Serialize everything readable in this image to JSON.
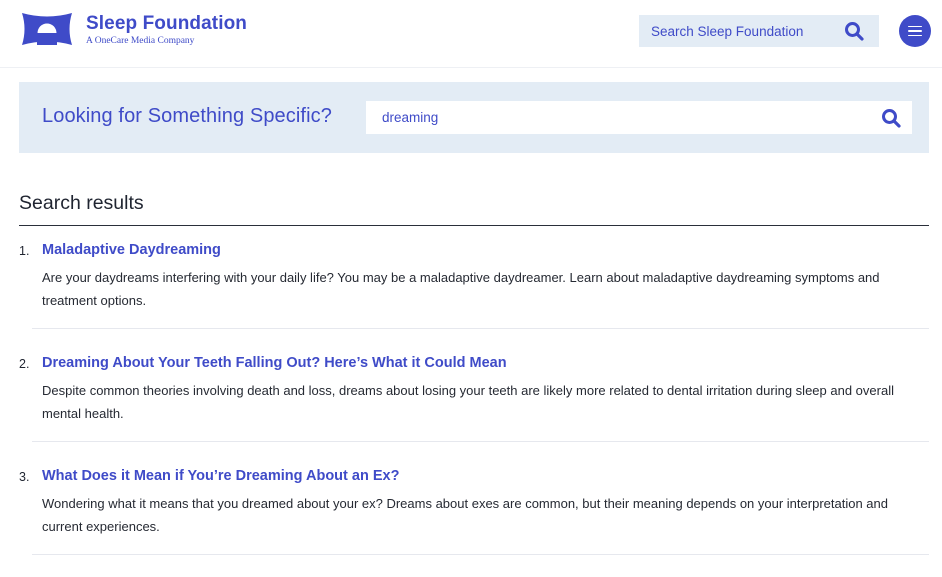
{
  "header": {
    "logo_title": "Sleep Foundation",
    "logo_subtitle": "A OneCare Media Company",
    "search_placeholder": "Search Sleep Foundation",
    "search_icon": "search-icon",
    "menu_icon": "menu-icon"
  },
  "search_panel": {
    "title": "Looking for Something Specific?",
    "query": "dreaming",
    "search_icon": "search-icon"
  },
  "results": {
    "heading": "Search results",
    "items": [
      {
        "number": "1.",
        "title": "Maladaptive Daydreaming",
        "description": "Are your daydreams interfering with your daily life? You may be a maladaptive daydreamer. Learn about maladaptive daydreaming symptoms and treatment options."
      },
      {
        "number": "2.",
        "title": "Dreaming About Your Teeth Falling Out? Here’s What it Could Mean",
        "description": "Despite common theories involving death and loss, dreams about losing your teeth are likely more related to dental irritation during sleep and overall mental health."
      },
      {
        "number": "3.",
        "title": "What Does it Mean if You’re Dreaming About an Ex?",
        "description": "Wondering what it means that you dreamed about your ex? Dreams about exes are common, but their meaning depends on your interpretation and current experiences."
      }
    ]
  },
  "colors": {
    "brand": "#3f4bc8",
    "panel": "#e3ecf5",
    "text": "#1f2430"
  }
}
